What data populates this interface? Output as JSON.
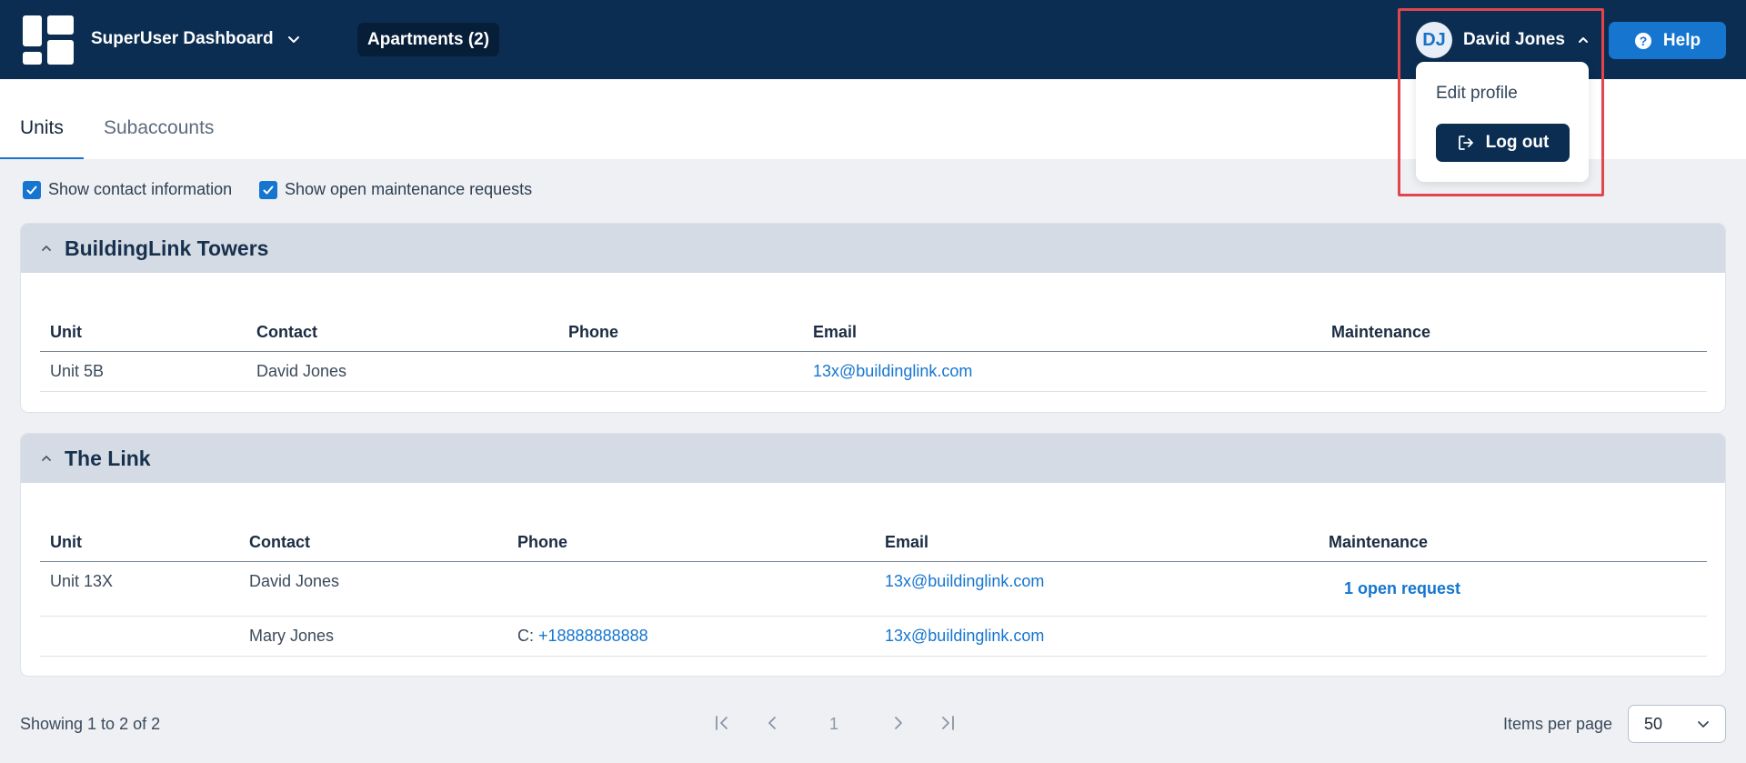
{
  "header": {
    "dashboard_title": "SuperUser Dashboard",
    "apartments_label": "Apartments (2)",
    "user": {
      "initials": "DJ",
      "name": "David Jones"
    },
    "help_label": "Help"
  },
  "user_menu": {
    "edit_profile": "Edit profile",
    "logout": "Log out"
  },
  "tabs": [
    {
      "label": "Units",
      "active": true
    },
    {
      "label": "Subaccounts",
      "active": false
    }
  ],
  "filters": {
    "show_contact": "Show contact information",
    "show_maintenance": "Show open maintenance requests"
  },
  "buildings": [
    {
      "name": "BuildingLink Towers",
      "columns": [
        "Unit",
        "Contact",
        "Phone",
        "Email",
        "Maintenance"
      ],
      "rows": [
        {
          "unit": "Unit 5B",
          "contact": "David Jones",
          "phone_prefix": "",
          "phone": "",
          "email": "13x@buildinglink.com",
          "maintenance": ""
        }
      ]
    },
    {
      "name": "The Link",
      "columns": [
        "Unit",
        "Contact",
        "Phone",
        "Email",
        "Maintenance"
      ],
      "rows": [
        {
          "unit": "Unit 13X",
          "contact": "David Jones",
          "phone_prefix": "",
          "phone": "",
          "email": "13x@buildinglink.com",
          "maintenance": "1 open request"
        },
        {
          "unit": "",
          "contact": "Mary Jones",
          "phone_prefix": "C: ",
          "phone": "+18888888888",
          "email": "13x@buildinglink.com",
          "maintenance": ""
        }
      ]
    }
  ],
  "pagination": {
    "showing": "Showing 1 to 2 of 2",
    "current_page": "1",
    "items_per_page_label": "Items per page",
    "items_per_page_value": "50"
  },
  "colors": {
    "header_bg": "#0b2d52",
    "accent": "#1575cf",
    "highlight": "#e0464b"
  }
}
